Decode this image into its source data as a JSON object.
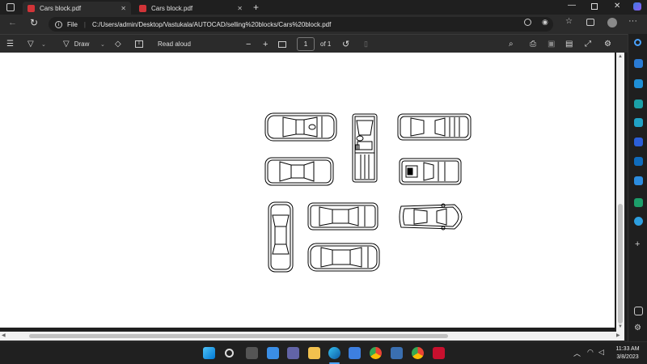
{
  "tabs": [
    {
      "label": "Cars block.pdf",
      "active": true
    },
    {
      "label": "Cars block.pdf",
      "active": false
    }
  ],
  "address": {
    "prefix": "File",
    "url": "C:/Users/admin/Desktop/Vastukala/AUTOCAD/selling%20blocks/Cars%20block.pdf"
  },
  "pdf_toolbar": {
    "draw_label": "Draw",
    "read_aloud_label": "Read aloud",
    "zoom_out": "−",
    "zoom_in": "+",
    "page_current": "1",
    "page_total": "of 1"
  },
  "taskbar": {
    "time": "11:33 AM",
    "date": "3/8/2023"
  },
  "colors": {
    "accent": "#0078d4",
    "pdf_icon": "#d13438"
  }
}
